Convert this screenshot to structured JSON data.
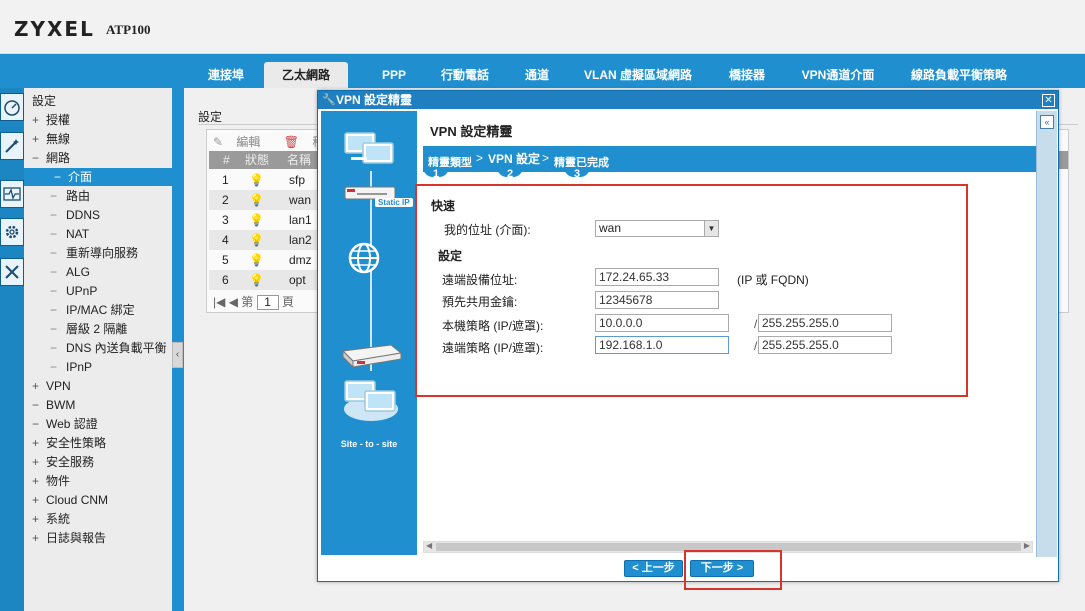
{
  "header": {
    "brand": "ZYXEL",
    "model": "ATP100"
  },
  "nav": {
    "tabs": [
      {
        "label": "連接埠"
      },
      {
        "label": "乙太網路",
        "active": true
      },
      {
        "label": "PPP"
      },
      {
        "label": "行動電話"
      },
      {
        "label": "通道"
      },
      {
        "label": "VLAN 虛擬區域網路"
      },
      {
        "label": "橋接器"
      },
      {
        "label": "VPN通道介面"
      },
      {
        "label": "線路負載平衡策略"
      }
    ]
  },
  "sidebar": {
    "title": "設定",
    "items": [
      {
        "label": "授權",
        "expander": "+"
      },
      {
        "label": "無線",
        "expander": "+"
      },
      {
        "label": "網路",
        "expander": "−"
      },
      {
        "label": "介面",
        "active": true
      },
      {
        "label": "路由"
      },
      {
        "label": "DDNS"
      },
      {
        "label": "NAT"
      },
      {
        "label": "重新導向服務"
      },
      {
        "label": "ALG"
      },
      {
        "label": "UPnP"
      },
      {
        "label": "IP/MAC 綁定"
      },
      {
        "label": "層級 2 隔離"
      },
      {
        "label": "DNS 內送負載平衡"
      },
      {
        "label": "IPnP"
      },
      {
        "label": "VPN",
        "expander": "+"
      },
      {
        "label": "BWM",
        "expander": "−"
      },
      {
        "label": "Web 認證",
        "expander": "−"
      },
      {
        "label": "安全性策略",
        "expander": "+"
      },
      {
        "label": "安全服務",
        "expander": "+"
      },
      {
        "label": "物件",
        "expander": "+"
      },
      {
        "label": "Cloud CNM",
        "expander": "+"
      },
      {
        "label": "系統",
        "expander": "+"
      },
      {
        "label": "日誌與報告",
        "expander": "+"
      }
    ]
  },
  "main": {
    "section_title": "設定",
    "toolbar": {
      "edit": "編輯",
      "remove": "移除"
    },
    "columns": [
      "#",
      "狀態",
      "名稱"
    ],
    "rows": [
      {
        "num": "1",
        "name": "sfp"
      },
      {
        "num": "2",
        "name": "wan"
      },
      {
        "num": "3",
        "name": "lan1"
      },
      {
        "num": "4",
        "name": "lan2"
      },
      {
        "num": "5",
        "name": "dmz"
      },
      {
        "num": "6",
        "name": "opt"
      }
    ],
    "pager": {
      "page_prefix": "第",
      "page": "1",
      "page_suffix": "頁"
    }
  },
  "dialog": {
    "title": "VPN 設定精靈",
    "heading": "VPN 設定精靈",
    "steps": [
      {
        "label": "精靈類型",
        "num": "1"
      },
      {
        "label": "VPN 設定",
        "num": "2",
        "current": true
      },
      {
        "label": "精靈已完成",
        "num": "3"
      }
    ],
    "illustration": {
      "static_ip": "Static IP",
      "caption": "Site - to - site"
    },
    "form": {
      "quick_title": "快速",
      "my_address_label": "我的位址 (介面):",
      "my_address_value": "wan",
      "settings_title": "設定",
      "remote_gateway_label": "遠端設備位址:",
      "remote_gateway_value": "172.24.65.33",
      "remote_gateway_hint": "(IP 或 FQDN)",
      "psk_label": "預先共用金鑰:",
      "psk_value": "12345678",
      "local_policy_label": "本機策略 (IP/遮罩):",
      "local_policy_ip": "10.0.0.0",
      "local_policy_mask": "255.255.255.0",
      "remote_policy_label": "遠端策略 (IP/遮罩):",
      "remote_policy_ip": "192.168.1.0",
      "remote_policy_mask": "255.255.255.0"
    },
    "buttons": {
      "prev": "< 上一步",
      "next": "下一步 >"
    }
  },
  "colors": {
    "accent": "#1f8fcf",
    "highlight": "#d9342b"
  }
}
